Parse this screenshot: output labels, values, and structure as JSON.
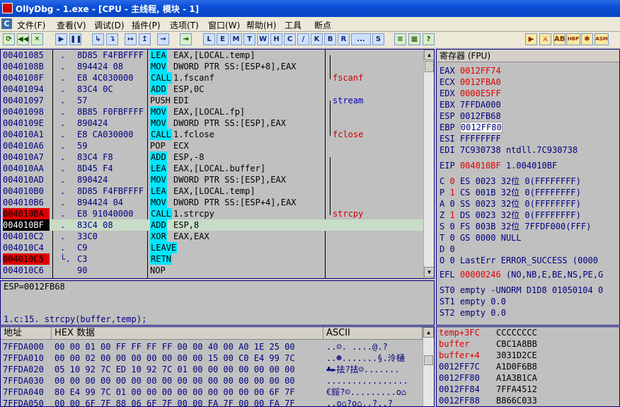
{
  "title": "OllyDbg - 1.exe - [CPU - 主线程, 模块 - 1]",
  "menu": [
    "文件(F)",
    "查看(V)",
    "调试(D)",
    "插件(P)",
    "选项(T)",
    "窗口(W)",
    "帮助(H)",
    "工具",
    "断点"
  ],
  "toolbar": {
    "left": [
      "⟳",
      "◀◀",
      "✕",
      "▶",
      "❚❚",
      "↳",
      "↴",
      "↦",
      "↥",
      "→",
      "⇥"
    ],
    "letters": [
      "L",
      "E",
      "M",
      "T",
      "W",
      "H",
      "C",
      "/",
      "K",
      "B",
      "R",
      "...",
      "S"
    ],
    "right": [
      "≡",
      "▦",
      "?"
    ],
    "plugins": [
      "▶",
      "⚔",
      "AB",
      "HBP",
      "✱",
      "ASM"
    ]
  },
  "cpu": {
    "rows": [
      {
        "addr": "00401085",
        "mark": ".",
        "hex": "8D85 F4FBFFFF",
        "mnem": "LEA",
        "args": "EAX,[LOCAL.temp]",
        "cmt": "",
        "addr_style": "",
        "mnem_hl": true
      },
      {
        "addr": "0040108B",
        "mark": ".",
        "hex": "894424 08",
        "mnem": "MOV",
        "args": "DWORD PTR SS:[ESP+8],EAX",
        "cmt": "",
        "addr_style": "",
        "mnem_hl": true
      },
      {
        "addr": "0040108F",
        "mark": ".",
        "hex": "E8 4C030000",
        "mnem": "CALL",
        "args": "1.fscanf",
        "cmt": "fscanf",
        "addr_style": "",
        "mnem_hl": true
      },
      {
        "addr": "00401094",
        "mark": ".",
        "hex": "83C4 0C",
        "mnem": "ADD",
        "args": "ESP,0C",
        "cmt": "",
        "addr_style": "",
        "mnem_hl": true
      },
      {
        "addr": "00401097",
        "mark": ".",
        "hex": "57",
        "mnem": "PUSH",
        "args": "EDI",
        "cmt": "stream",
        "addr_style": "",
        "mnem_hl": false
      },
      {
        "addr": "00401098",
        "mark": ".",
        "hex": "8B85 F0FBFFFF",
        "mnem": "MOV",
        "args": "EAX,[LOCAL.fp]",
        "cmt": "",
        "addr_style": "",
        "mnem_hl": true
      },
      {
        "addr": "0040109E",
        "mark": ".",
        "hex": "890424",
        "mnem": "MOV",
        "args": "DWORD PTR SS:[ESP],EAX",
        "cmt": "",
        "addr_style": "",
        "mnem_hl": true
      },
      {
        "addr": "004010A1",
        "mark": ".",
        "hex": "E8 CA030000",
        "mnem": "CALL",
        "args": "1.fclose",
        "cmt": "fclose",
        "addr_style": "",
        "mnem_hl": true
      },
      {
        "addr": "004010A6",
        "mark": ".",
        "hex": "59",
        "mnem": "POP",
        "args": "ECX",
        "cmt": "",
        "addr_style": "",
        "mnem_hl": false
      },
      {
        "addr": "004010A7",
        "mark": ".",
        "hex": "83C4 F8",
        "mnem": "ADD",
        "args": "ESP,-8",
        "cmt": "",
        "addr_style": "",
        "mnem_hl": true
      },
      {
        "addr": "004010AA",
        "mark": ".",
        "hex": "8D45 F4",
        "mnem": "LEA",
        "args": "EAX,[LOCAL.buffer]",
        "cmt": "",
        "addr_style": "",
        "mnem_hl": true
      },
      {
        "addr": "004010AD",
        "mark": ".",
        "hex": "890424",
        "mnem": "MOV",
        "args": "DWORD PTR SS:[ESP],EAX",
        "cmt": "",
        "addr_style": "",
        "mnem_hl": true
      },
      {
        "addr": "004010B0",
        "mark": ".",
        "hex": "8D85 F4FBFFFF",
        "mnem": "LEA",
        "args": "EAX,[LOCAL.temp]",
        "cmt": "",
        "addr_style": "",
        "mnem_hl": true
      },
      {
        "addr": "004010B6",
        "mark": ".",
        "hex": "894424 04",
        "mnem": "MOV",
        "args": "DWORD PTR SS:[ESP+4],EAX",
        "cmt": "",
        "addr_style": "",
        "mnem_hl": true
      },
      {
        "addr": "004010BA",
        "mark": ".",
        "hex": "E8 91040000",
        "mnem": "CALL",
        "args": "1.strcpy",
        "cmt": "strcpy",
        "addr_style": "bp",
        "mnem_hl": true
      },
      {
        "addr": "004010BF",
        "mark": ".",
        "hex": "83C4 08",
        "mnem": "ADD",
        "args": "ESP,8",
        "cmt": "",
        "addr_style": "cur",
        "mnem_hl": true
      },
      {
        "addr": "004010C2",
        "mark": ".",
        "hex": "33C0",
        "mnem": "XOR",
        "args": "EAX,EAX",
        "cmt": "",
        "addr_style": "",
        "mnem_hl": true
      },
      {
        "addr": "004010C4",
        "mark": ".",
        "hex": "C9",
        "mnem": "LEAVE",
        "args": "",
        "cmt": "",
        "addr_style": "",
        "mnem_hl": true
      },
      {
        "addr": "004010C5",
        "mark": "└.",
        "hex": "C3",
        "mnem": "RETN",
        "args": "",
        "cmt": "",
        "addr_style": "bp",
        "mnem_hl": true
      },
      {
        "addr": "004010C6",
        "mark": "",
        "hex": "90",
        "mnem": "NOP",
        "args": "",
        "cmt": "",
        "addr_style": "",
        "mnem_hl": false
      }
    ]
  },
  "info": {
    "line1": "ESP=0012FB68",
    "line2": "1.c:15.  strcpy(buffer,temp);"
  },
  "regs": {
    "header": "寄存器 (FPU)",
    "gp": [
      {
        "name": "EAX",
        "value": "0012FF74",
        "changed": true,
        "extra": ""
      },
      {
        "name": "ECX",
        "value": "0012FBA0",
        "changed": true,
        "extra": ""
      },
      {
        "name": "EDX",
        "value": "0000E5FF",
        "changed": true,
        "extra": ""
      },
      {
        "name": "EBX",
        "value": "7FFDA000",
        "changed": false,
        "extra": ""
      },
      {
        "name": "ESP",
        "value": "0012FB68",
        "changed": false,
        "extra": ""
      },
      {
        "name": "EBP",
        "value": "0012FF80",
        "changed": false,
        "extra": "",
        "box": true
      },
      {
        "name": "ESI",
        "value": "FFFFFFFF",
        "changed": false,
        "extra": ""
      },
      {
        "name": "EDI",
        "value": "7C930738",
        "changed": false,
        "extra": "ntdll.7C930738"
      }
    ],
    "eip": {
      "name": "EIP",
      "value": "004010BF",
      "extra": "1.004010BF"
    },
    "flags": [
      {
        "f": "C",
        "v": "0",
        "seg": "ES 0023 32位 0(FFFFFFFF)",
        "changed": true
      },
      {
        "f": "P",
        "v": "1",
        "seg": "CS 001B 32位 0(FFFFFFFF)",
        "changed": true
      },
      {
        "f": "A",
        "v": "0",
        "seg": "SS 0023 32位 0(FFFFFFFF)",
        "changed": false
      },
      {
        "f": "Z",
        "v": "1",
        "seg": "DS 0023 32位 0(FFFFFFFF)",
        "changed": true
      },
      {
        "f": "S",
        "v": "0",
        "seg": "FS 003B 32位 7FFDF000(FFF)",
        "changed": false
      },
      {
        "f": "T",
        "v": "0",
        "seg": "GS 0000 NULL",
        "changed": false
      },
      {
        "f": "D",
        "v": "0",
        "seg": "",
        "changed": false
      },
      {
        "f": "O",
        "v": "0",
        "seg": "LastErr ERROR_SUCCESS (0000",
        "changed": false
      }
    ],
    "efl": {
      "name": "EFL",
      "value": "00000246",
      "extra": "(NO,NB,E,BE,NS,PE,G"
    },
    "fpu": [
      "ST0 empty -UNORM D1D8 01050104 0",
      "ST1 empty 0.0",
      "ST2 empty 0.0"
    ]
  },
  "dump": {
    "headers": {
      "addr": "地址",
      "hex": "HEX 数据",
      "ascii": "ASCII"
    },
    "rows": [
      {
        "a": "7FFDA000",
        "h": "00 00 01 00 FF FF FF FF 00 00 40 00 A0 1E 25 00",
        "c": "..☺.  ....@.?"
      },
      {
        "a": "7FFDA010",
        "h": "00 00 02 00 00 00 00 00 00 00 15 00 C0 E4 99 7C",
        "c": "..☻.......§.泠樋"
      },
      {
        "a": "7FFDA020",
        "h": "05 10 92 7C ED 10 92 7C 01 00 00 00 00 00 00 00",
        "c": "♣►抾?抾☺......."
      },
      {
        "a": "7FFDA030",
        "h": "00 00 00 00 00 00 00 00 00 00 00 00 00 00 00 00",
        "c": "................"
      },
      {
        "a": "7FFDA040",
        "h": "80 E4 99 7C 01 00 00 00 00 00 00 00 00 00 6F 7F",
        "c": "€鋖?☺.........o⌂"
      },
      {
        "a": "7FFDA050",
        "h": "00 00 6F 7F 88 06 6F 7F 00 00 FA 7F 00 00 FA 7F",
        "c": "..o⌂?o⌂..?..?"
      }
    ]
  },
  "stack": {
    "rows": [
      {
        "a": "temp+3FC",
        "v": "CCCCCCCC",
        "label": true
      },
      {
        "a": "buffer",
        "v": "CBC1A8BB",
        "label": true
      },
      {
        "a": "buffer+4",
        "v": "3031D2CE",
        "label": true
      },
      {
        "a": "0012FF7C",
        "v": "A1D0F6B8",
        "label": false
      },
      {
        "a": "0012FF80",
        "v": "A1A3B1CA",
        "label": false
      },
      {
        "a": "0012FF84",
        "v": "7FFA4512",
        "label": false
      },
      {
        "a": "0012FF88",
        "v": "B866C033",
        "label": false
      }
    ]
  },
  "colors": {
    "breakpoint": "#e00000",
    "current": "#000000",
    "mnemonic_highlight": "#00e6ff",
    "comment": "#d00000",
    "changed_register": "#e00000"
  }
}
